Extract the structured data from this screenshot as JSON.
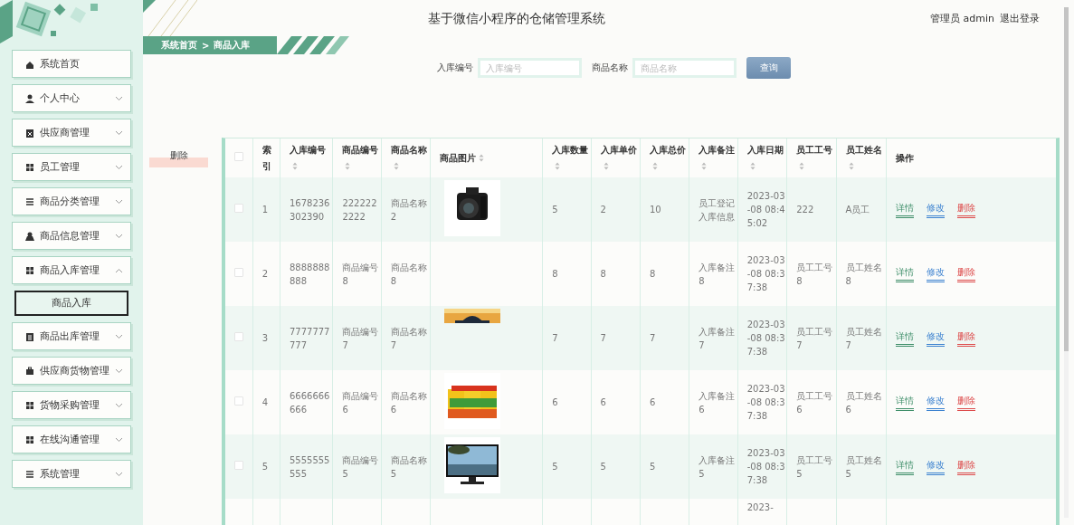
{
  "sidebar": {
    "items": [
      {
        "label": "系统首页"
      },
      {
        "label": "个人中心",
        "expanded": false
      },
      {
        "label": "供应商管理",
        "expanded": false
      },
      {
        "label": "员工管理",
        "expanded": false
      },
      {
        "label": "商品分类管理",
        "expanded": false
      },
      {
        "label": "商品信息管理",
        "expanded": false
      },
      {
        "label": "商品入库管理",
        "expanded": true,
        "children": [
          {
            "label": "商品入库",
            "selected": true
          }
        ]
      },
      {
        "label": "商品出库管理",
        "expanded": false
      },
      {
        "label": "供应商货物管理",
        "expanded": false
      },
      {
        "label": "货物采购管理",
        "expanded": false
      },
      {
        "label": "在线沟通管理",
        "expanded": false
      },
      {
        "label": "系统管理",
        "expanded": false
      }
    ]
  },
  "header": {
    "title": "基于微信小程序的仓储管理系统",
    "user": "管理员 admin",
    "logout": "退出登录"
  },
  "breadcrumb": [
    "系统首页",
    ">",
    "商品入库"
  ],
  "search": {
    "fields": [
      {
        "label": "入库编号",
        "placeholder": "入库编号"
      },
      {
        "label": "商品名称",
        "placeholder": "商品名称"
      }
    ],
    "button": "查询"
  },
  "delete_button": "删除",
  "table": {
    "select_all": {
      "checked": false
    },
    "columns": [
      {
        "label": "索引",
        "sortable": false
      },
      {
        "label": "入库编号",
        "sortable": true
      },
      {
        "label": "商品编号",
        "sortable": true
      },
      {
        "label": "商品名称",
        "sortable": true
      },
      {
        "label": "商品图片",
        "sortable": true
      },
      {
        "label": "入库数量",
        "sortable": true
      },
      {
        "label": "入库单价",
        "sortable": true
      },
      {
        "label": "入库总价",
        "sortable": true
      },
      {
        "label": "入库备注",
        "sortable": true
      },
      {
        "label": "入库日期",
        "sortable": true
      },
      {
        "label": "员工工号",
        "sortable": true
      },
      {
        "label": "员工姓名",
        "sortable": true
      },
      {
        "label": "操作",
        "sortable": false
      }
    ],
    "rows": [
      {
        "checked": false,
        "cells": [
          "1",
          "1678236302390",
          "2222222222",
          "商品名称2",
          {
            "kind": "picture"
          },
          "5",
          "2",
          "10",
          "员工登记入库信息",
          "2023-03-08 08:45:02",
          "222",
          "A员工"
        ],
        "actions": [
          {
            "label": "详情",
            "kind": "view"
          },
          {
            "label": "修改",
            "kind": "edit"
          },
          {
            "label": "删除",
            "kind": "delete"
          }
        ]
      },
      {
        "checked": false,
        "cells": [
          "2",
          "8888888888",
          "商品编号8",
          "商品名称8",
          null,
          "8",
          "8",
          "8",
          "入库备注8",
          "2023-03-08 08:37:38",
          "员工工号8",
          "员工姓名8"
        ],
        "actions": [
          {
            "label": "详情",
            "kind": "view"
          },
          {
            "label": "修改",
            "kind": "edit"
          },
          {
            "label": "删除",
            "kind": "delete"
          }
        ]
      },
      {
        "checked": false,
        "cells": [
          "3",
          "7777777777",
          "商品编号7",
          "商品名称7",
          {
            "kind": "picture"
          },
          "7",
          "7",
          "7",
          "入库备注7",
          "2023-03-08 08:37:38",
          "员工工号7",
          "员工姓名7"
        ],
        "actions": [
          {
            "label": "详情",
            "kind": "view"
          },
          {
            "label": "修改",
            "kind": "edit"
          },
          {
            "label": "删除",
            "kind": "delete"
          }
        ]
      },
      {
        "checked": false,
        "cells": [
          "4",
          "6666666666",
          "商品编号6",
          "商品名称6",
          {
            "kind": "picture"
          },
          "6",
          "6",
          "6",
          "入库备注6",
          "2023-03-08 08:37:38",
          "员工工号6",
          "员工姓名6"
        ],
        "actions": [
          {
            "label": "详情",
            "kind": "view"
          },
          {
            "label": "修改",
            "kind": "edit"
          },
          {
            "label": "删除",
            "kind": "delete"
          }
        ]
      },
      {
        "checked": false,
        "cells": [
          "5",
          "5555555555",
          "商品编号5",
          "商品名称5",
          {
            "kind": "picture"
          },
          "5",
          "5",
          "5",
          "入库备注5",
          "2023-03-08 08:37:38",
          "员工工号5",
          "员工姓名5"
        ],
        "actions": [
          {
            "label": "详情",
            "kind": "view"
          },
          {
            "label": "修改",
            "kind": "edit"
          },
          {
            "label": "删除",
            "kind": "delete"
          }
        ]
      }
    ],
    "partial_row": {
      "date": "2023-"
    }
  }
}
